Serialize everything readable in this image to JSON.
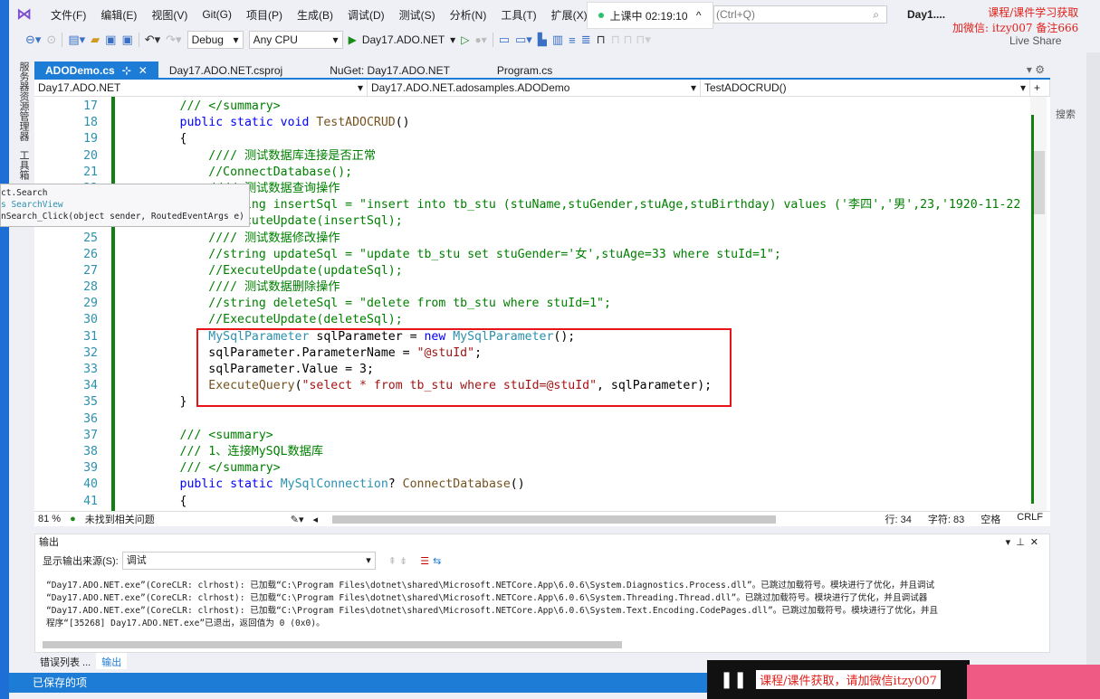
{
  "menu": {
    "items": [
      "文件(F)",
      "编辑(E)",
      "视图(V)",
      "Git(G)",
      "项目(P)",
      "生成(B)",
      "调试(D)",
      "测试(S)",
      "分析(N)",
      "工具(T)",
      "扩展(X)"
    ]
  },
  "recording": {
    "label": "上课中 02:19:10"
  },
  "search": {
    "placeholder": "(Ctrl+Q)"
  },
  "solution_title": "Day1....",
  "watermark": {
    "line1": "课程/课件学习获取",
    "line2": "加微信: itzy007 备注666"
  },
  "toolbar": {
    "config": "Debug",
    "platform": "Any CPU",
    "run_target": "Day17.ADO.NET",
    "live_share": "Live Share"
  },
  "left_tabs": [
    "服务器资源管理器",
    "工具箱"
  ],
  "tabs": [
    {
      "label": "ADODemo.cs",
      "active": true
    },
    {
      "label": "Day17.ADO.NET.csproj"
    },
    {
      "label": "NuGet: Day17.ADO.NET"
    },
    {
      "label": "Program.cs"
    }
  ],
  "navbar": {
    "project": "Day17.ADO.NET",
    "class": "Day17.ADO.NET.adosamples.ADODemo",
    "member": "TestADOCRUD()"
  },
  "code": [
    {
      "n": "17",
      "s": [
        [
          "        ",
          ""
        ],
        [
          "/// </summary>",
          "cm"
        ]
      ]
    },
    {
      "n": "18",
      "s": [
        [
          "        ",
          ""
        ],
        [
          "public static void ",
          "kw"
        ],
        [
          "TestADOCRUD",
          "me"
        ],
        [
          "()",
          "tx"
        ]
      ]
    },
    {
      "n": "19",
      "s": [
        [
          "        {",
          "tx"
        ]
      ]
    },
    {
      "n": "20",
      "s": [
        [
          "            ",
          ""
        ],
        [
          "//// 测试数据库连接是否正常",
          "cm"
        ]
      ]
    },
    {
      "n": "21",
      "s": [
        [
          "            ",
          ""
        ],
        [
          "//ConnectDatabase();",
          "cm"
        ]
      ]
    },
    {
      "n": "22",
      "s": [
        [
          "            ",
          ""
        ],
        [
          "//// 测试数据查询操作",
          "cm"
        ]
      ]
    },
    {
      "n": "23",
      "s": [
        [
          "            ",
          ""
        ],
        [
          "//string insertSql = \"insert into tb_stu (stuName,stuGender,stuAge,stuBirthday) values ('李四','男',23,'1920-11-22",
          "cm"
        ]
      ]
    },
    {
      "n": "24",
      "s": [
        [
          "            ",
          ""
        ],
        [
          "//ExecuteUpdate(insertSql);",
          "cm"
        ]
      ]
    },
    {
      "n": "25",
      "s": [
        [
          "            ",
          ""
        ],
        [
          "//// 测试数据修改操作",
          "cm"
        ]
      ]
    },
    {
      "n": "26",
      "s": [
        [
          "            ",
          ""
        ],
        [
          "//string updateSql = \"update tb_stu set stuGender='女',stuAge=33 where stuId=1\";",
          "cm"
        ]
      ]
    },
    {
      "n": "27",
      "s": [
        [
          "            ",
          ""
        ],
        [
          "//ExecuteUpdate(updateSql);",
          "cm"
        ]
      ]
    },
    {
      "n": "28",
      "s": [
        [
          "            ",
          ""
        ],
        [
          "//// 测试数据删除操作",
          "cm"
        ]
      ]
    },
    {
      "n": "29",
      "s": [
        [
          "            ",
          ""
        ],
        [
          "//string deleteSql = \"delete from tb_stu where stuId=1\";",
          "cm"
        ]
      ]
    },
    {
      "n": "30",
      "s": [
        [
          "            ",
          ""
        ],
        [
          "//ExecuteUpdate(deleteSql);",
          "cm"
        ]
      ]
    },
    {
      "n": "31",
      "s": [
        [
          "            ",
          ""
        ],
        [
          "MySqlParameter ",
          "ty"
        ],
        [
          "sqlParameter = ",
          "tx"
        ],
        [
          "new ",
          "kw"
        ],
        [
          "MySqlParameter",
          "ty"
        ],
        [
          "();",
          "tx"
        ]
      ]
    },
    {
      "n": "32",
      "s": [
        [
          "            ",
          ""
        ],
        [
          "sqlParameter.ParameterName = ",
          "tx"
        ],
        [
          "\"@stuId\"",
          "st"
        ],
        [
          ";",
          "tx"
        ]
      ]
    },
    {
      "n": "33",
      "s": [
        [
          "            ",
          ""
        ],
        [
          "sqlParameter.Value = 3;",
          "tx"
        ]
      ]
    },
    {
      "n": "34",
      "s": [
        [
          "            ",
          ""
        ],
        [
          "ExecuteQuery",
          "me"
        ],
        [
          "(",
          "tx"
        ],
        [
          "\"select * from tb_stu where stuId=@stuId\"",
          "st"
        ],
        [
          ", sqlParameter);",
          "tx"
        ]
      ]
    },
    {
      "n": "35",
      "s": [
        [
          "        }",
          "tx"
        ]
      ]
    },
    {
      "n": "36",
      "s": []
    },
    {
      "n": "37",
      "s": [
        [
          "        ",
          ""
        ],
        [
          "/// <summary>",
          "cm"
        ]
      ]
    },
    {
      "n": "38",
      "s": [
        [
          "        ",
          ""
        ],
        [
          "/// 1、连接MySQL数据库",
          "cm"
        ]
      ]
    },
    {
      "n": "39",
      "s": [
        [
          "        ",
          ""
        ],
        [
          "/// </summary>",
          "cm"
        ]
      ]
    },
    {
      "n": "40",
      "s": [
        [
          "        ",
          ""
        ],
        [
          "public static ",
          "kw"
        ],
        [
          "MySqlConnection",
          "ty"
        ],
        [
          "? ",
          "tx"
        ],
        [
          "ConnectDatabase",
          "me"
        ],
        [
          "()",
          "tx"
        ]
      ]
    },
    {
      "n": "41",
      "s": [
        [
          "        {",
          "tx"
        ]
      ]
    }
  ],
  "tooltip": {
    "lines": [
      "ct.Search",
      "s SearchView",
      "nSearch_Click(object sender, RoutedEventArgs e)"
    ]
  },
  "editor_status": {
    "zoom": "81 %",
    "issues": "未找到相关问题",
    "line": "行: 34",
    "col": "字符: 83",
    "indent": "空格",
    "eol": "CRLF"
  },
  "output": {
    "title": "输出",
    "source_label": "显示输出来源(S):",
    "source": "调试",
    "lines": [
      "“Day17.ADO.NET.exe”(CoreCLR: clrhost): 已加载“C:\\Program Files\\dotnet\\shared\\Microsoft.NETCore.App\\6.0.6\\System.Diagnostics.Process.dll”。已跳过加载符号。模块进行了优化，并且调试",
      "“Day17.ADO.NET.exe”(CoreCLR: clrhost): 已加载“C:\\Program Files\\dotnet\\shared\\Microsoft.NETCore.App\\6.0.6\\System.Threading.Thread.dll”。已跳过加载符号。模块进行了优化，并且调试器",
      "“Day17.ADO.NET.exe”(CoreCLR: clrhost): 已加载“C:\\Program Files\\dotnet\\shared\\Microsoft.NETCore.App\\6.0.6\\System.Text.Encoding.CodePages.dll”。已跳过加载符号。模块进行了优化，并且",
      "程序“[35268] Day17.ADO.NET.exe”已退出，返回值为 0 (0x0)。"
    ]
  },
  "bottom_tabs": [
    "错误列表 ...",
    "输出"
  ],
  "statusbar": {
    "text": "已保存的项"
  },
  "right_pane": {
    "search": "搜索"
  },
  "player": {
    "watermark": "课程/课件获取，请加微信itzy007"
  }
}
